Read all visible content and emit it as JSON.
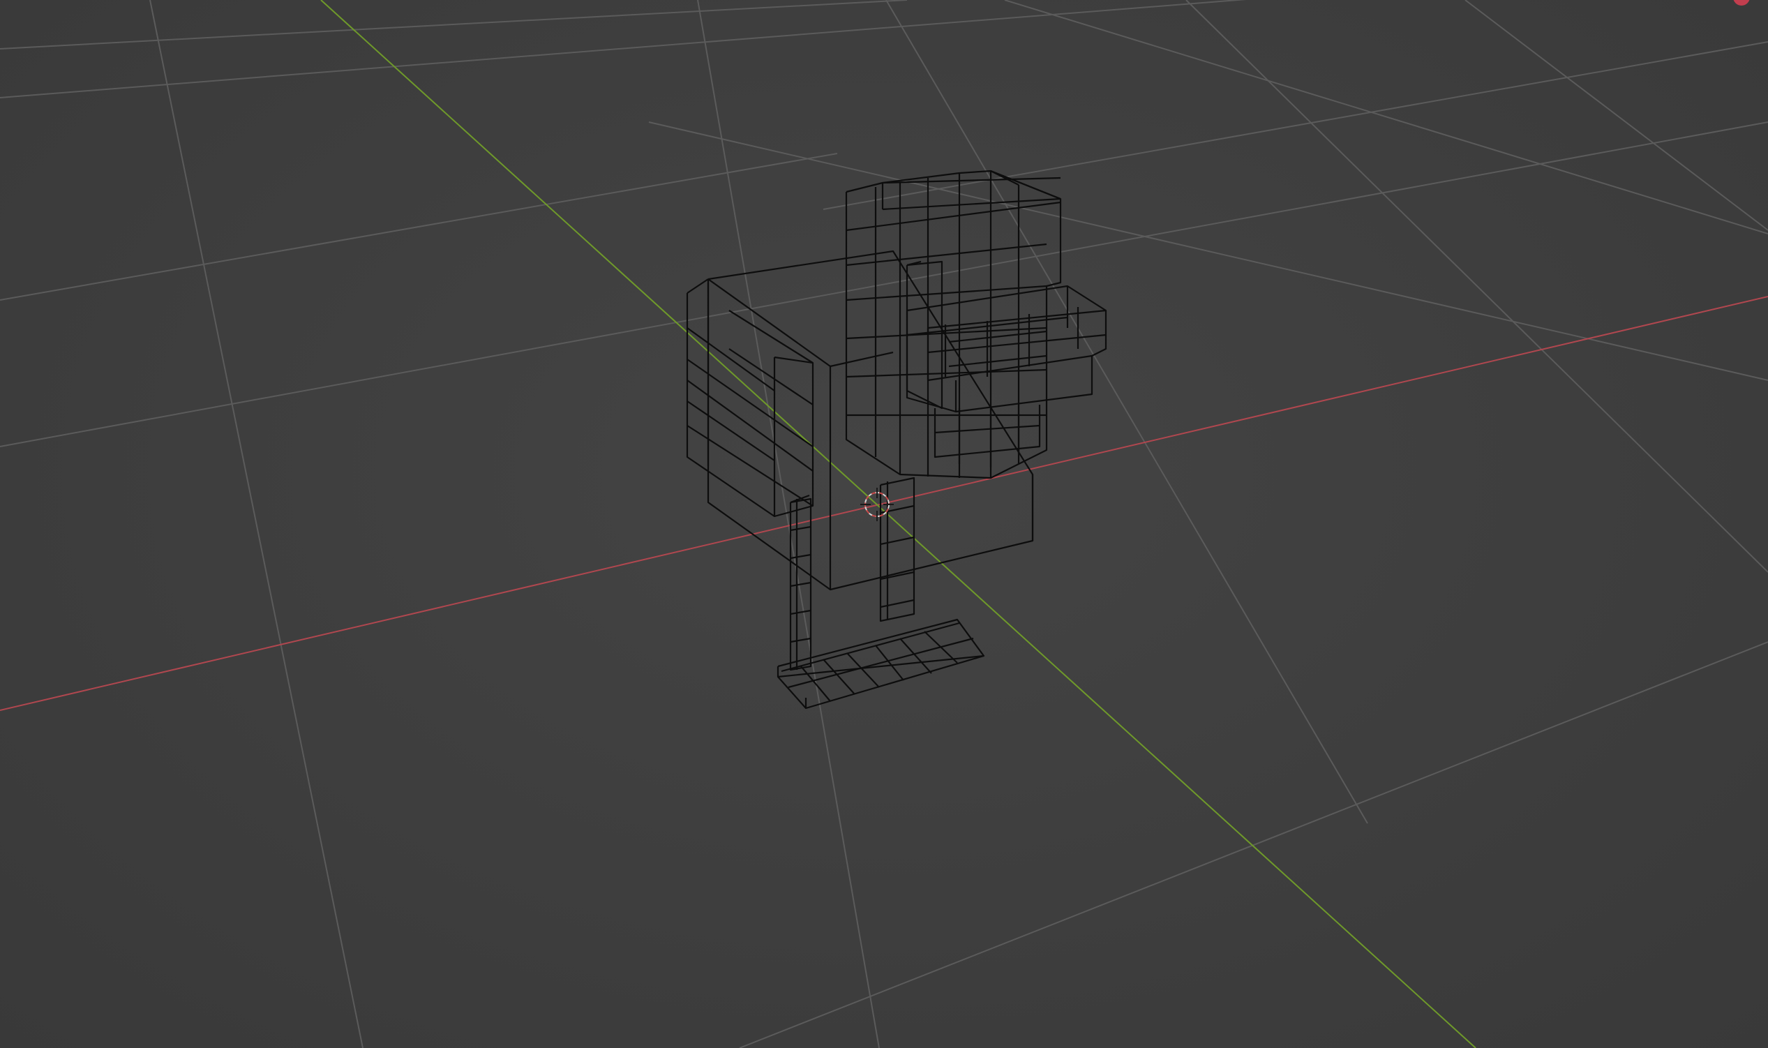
{
  "viewport": {
    "view_mode": "wireframe",
    "background_color": "#3d3d3d",
    "grid_color": "#5b5b5b",
    "axis_x_color": "#b0474f",
    "axis_y_color": "#6f9a2a",
    "wire_color": "#0d0d0d"
  },
  "scene": {
    "object": "voxel-bird-model",
    "icons": [
      "3d-cursor-icon"
    ]
  }
}
